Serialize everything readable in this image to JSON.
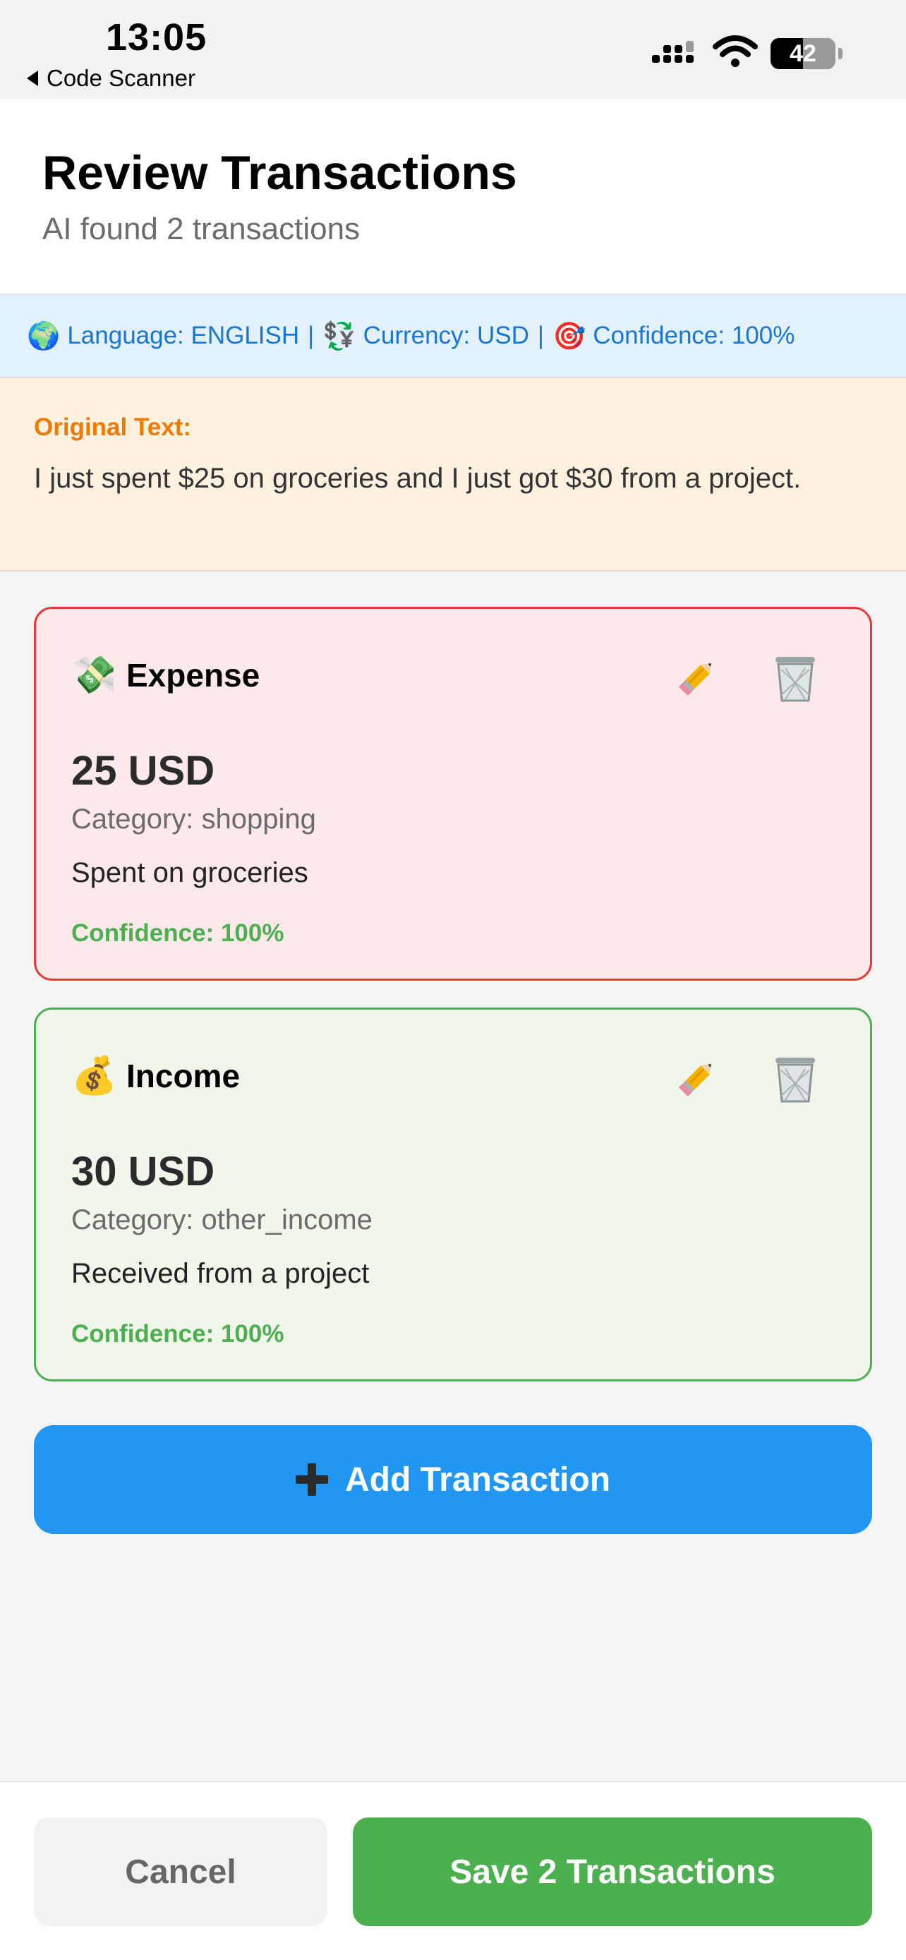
{
  "status_bar": {
    "time": "13:05",
    "back_app": "Code Scanner",
    "battery": "42",
    "icons": [
      "cellular-signal-icon",
      "wifi-icon",
      "battery-icon"
    ]
  },
  "header": {
    "title": "Review Transactions",
    "subtitle": "AI found 2 transactions"
  },
  "detection": {
    "language_icon": "🌍",
    "language": "Language: ENGLISH",
    "separator": "|",
    "currency_icon": "💱",
    "currency": "Currency: USD",
    "confidence_icon": "🎯",
    "confidence": "Confidence: 100%"
  },
  "original": {
    "label": "Original Text:",
    "text": "I just spent $25 on groceries and I just got $30 from a project."
  },
  "transactions": [
    {
      "type": "Expense",
      "icon": "💸",
      "amount": "25 USD",
      "category": "Category: shopping",
      "description": "Spent on groceries",
      "confidence": "Confidence: 100%",
      "accent": "#e53935"
    },
    {
      "type": "Income",
      "icon": "💰",
      "amount": "30 USD",
      "category": "Category: other_income",
      "description": "Received from a project",
      "confidence": "Confidence: 100%",
      "accent": "#4caf50"
    }
  ],
  "actions": {
    "add": "Add Transaction",
    "cancel": "Cancel",
    "save": "Save 2 Transactions"
  },
  "colors": {
    "primary": "#2196f3",
    "success": "#4caf50",
    "danger": "#e53935",
    "warning": "#ef7a00"
  }
}
